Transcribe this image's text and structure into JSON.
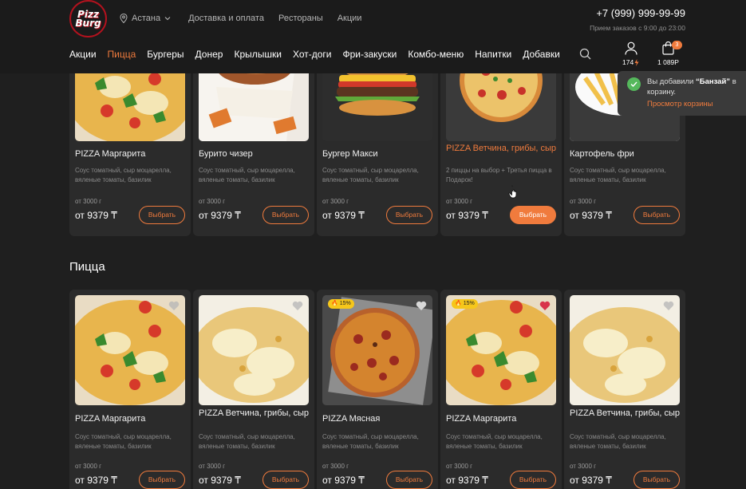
{
  "header": {
    "logo_line1": "Pizz",
    "logo_line2": "Burg",
    "city": "Астана",
    "top_links": [
      "Доставка и оплата",
      "Рестораны",
      "Акции"
    ],
    "phone": "+7 (999) 999-99-99",
    "hours": "Прием заказов с 9:00 до 23:00",
    "nav": [
      "Акции",
      "Пицца",
      "Бургеры",
      "Донер",
      "Крылышки",
      "Хот-доги",
      "Фри-закуски",
      "Комбо-меню",
      "Напитки",
      "Добавки"
    ],
    "active_nav": "Пицца",
    "user_points": "174",
    "cart_count": "3",
    "cart_total": "1 089Р"
  },
  "top_row": [
    {
      "title": "PIZZA Маргарита",
      "desc": "Соус томатный, сыр моцарелла, вяленые томаты, базилик",
      "weight": "от 3000 г",
      "price": "от 9379 ₸",
      "button": "Выбрать"
    },
    {
      "title": "Бурито чизер",
      "desc": "Соус томатный, сыр моцарелла, вяленые томаты, базилик",
      "weight": "от 3000 г",
      "price": "от 9379 ₸",
      "button": "Выбрать"
    },
    {
      "title": "Бургер Макси",
      "desc": "Соус томатный, сыр моцарелла, вяленые томаты, базилик",
      "weight": "от 3000 г",
      "price": "от 9379 ₸",
      "button": "Выбрать"
    },
    {
      "title": "PIZZA Ветчина, грибы, сыр",
      "desc": "2 пиццы на выбор + Третья пицца в Подарок!",
      "weight": "от 3000 г",
      "price": "от 9379 ₸",
      "button": "Выбрать"
    },
    {
      "title": "Картофель фри",
      "desc": "Соус томатный, сыр моцарелла, вяленые томаты, базилик",
      "weight": "от 3000 г",
      "price": "от 9379 ₸",
      "button": "Выбрать"
    }
  ],
  "section_title": "Пицца",
  "pizza_row": [
    {
      "title": "PIZZA Маргарита",
      "desc": "Соус томатный, сыр моцарелла, вяленые томаты, базилик",
      "weight": "от 3000 г",
      "price": "от 9379 ₸",
      "button": "Выбрать"
    },
    {
      "title": "PIZZA Ветчина, грибы, сыр",
      "desc": "Соус томатный, сыр моцарелла, вяленые томаты, базилик",
      "weight": "от 3000 г",
      "price": "от 9379 ₸",
      "button": "Выбрать"
    },
    {
      "title": "PIZZA Мясная",
      "desc": "Соус томатный, сыр моцарелла, вяленые томаты, базилик",
      "weight": "от 3000 г",
      "price": "от 9379 ₸",
      "button": "Выбрать",
      "badge": "15%"
    },
    {
      "title": "PIZZA Маргарита",
      "desc": "Соус томатный, сыр моцарелла, вяленые томаты, базилик",
      "weight": "от 3000 г",
      "price": "от 9379 ₸",
      "button": "Выбрать",
      "badge": "15%"
    },
    {
      "title": "PIZZA Ветчина, грибы, сыр",
      "desc": "Соус томатный, сыр моцарелла, вяленые томаты, базилик",
      "weight": "от 3000 г",
      "price": "от 9379 ₸",
      "button": "Выбрать"
    }
  ],
  "toast": {
    "prefix": "Вы добавили ",
    "item": "“Банзай”",
    "suffix": " в корзину.",
    "link": "Просмотр корзины"
  },
  "colors": {
    "accent": "#f07b3d",
    "bg": "#1f1f1f",
    "card": "#2b2b2b",
    "success": "#55b85c",
    "badge": "#f6c71a"
  }
}
